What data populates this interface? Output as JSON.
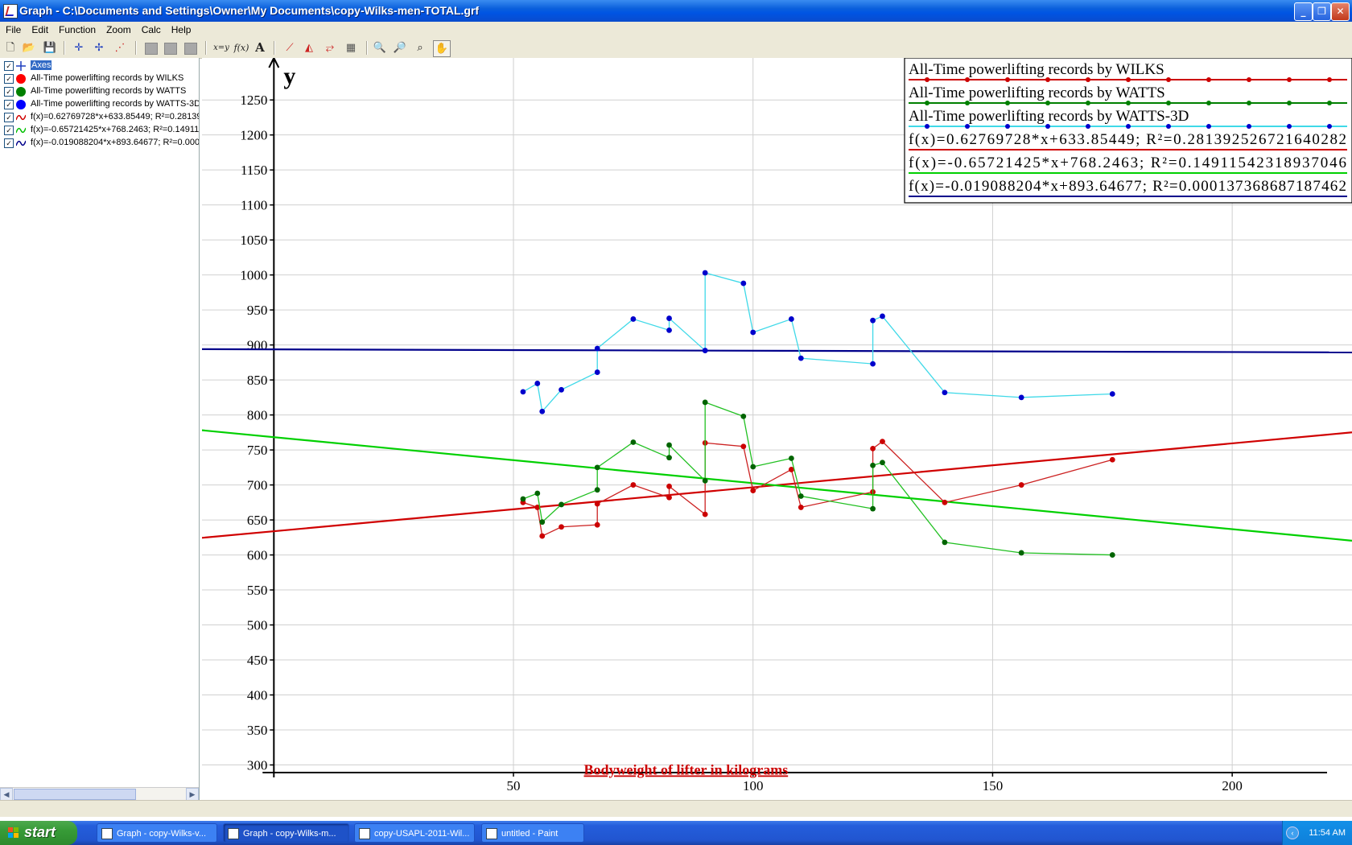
{
  "window": {
    "title": "Graph - C:\\Documents and Settings\\Owner\\My Documents\\copy-Wilks-men-TOTAL.grf"
  },
  "menu": [
    "File",
    "Edit",
    "Function",
    "Zoom",
    "Calc",
    "Help"
  ],
  "toolbar": {
    "xy_label": "x=y",
    "fx_label": "f(x)",
    "text_label": "A"
  },
  "panel": {
    "items": [
      {
        "label": "Axes",
        "checked": true,
        "icon": "axes-icon",
        "color": "#1f3fbf"
      },
      {
        "label": "All-Time powerlifting records by WILKS",
        "checked": true,
        "icon": "dot-icon",
        "color": "#ff0000"
      },
      {
        "label": "All-Time powerlifting records by WATTS",
        "checked": true,
        "icon": "dot-icon",
        "color": "#008000"
      },
      {
        "label": "All-Time powerlifting records by WATTS-3D",
        "checked": true,
        "icon": "dot-icon",
        "color": "#0000ff"
      },
      {
        "label": "f(x)=0.62769728*x+633.85449; R²=0.28139:",
        "checked": true,
        "icon": "curve-icon",
        "color": "#d00000"
      },
      {
        "label": "f(x)=-0.65721425*x+768.2463; R²=0.149115",
        "checked": true,
        "icon": "curve-icon",
        "color": "#00c000"
      },
      {
        "label": "f(x)=-0.019088204*x+893.64677; R²=0.0001",
        "checked": true,
        "icon": "curve-icon",
        "color": "#00008b"
      }
    ]
  },
  "chart_data": {
    "type": "scatter",
    "ylabel": "y",
    "annotation": "Bodyweight  of  lifter  in  kilograms",
    "x_ticks": [
      "50",
      "100",
      "150",
      "200"
    ],
    "y_ticks": [
      "300",
      "350",
      "400",
      "450",
      "500",
      "550",
      "600",
      "650",
      "700",
      "750",
      "800",
      "850",
      "900",
      "950",
      "1000",
      "1050",
      "1100",
      "1150",
      "1200",
      "1250"
    ],
    "xlim": [
      -15,
      225
    ],
    "ylim": [
      250,
      1310
    ],
    "legend_position": "top-right",
    "legend": [
      {
        "label": "All-Time powerlifting records by WILKS",
        "color": "#cc0000",
        "style": "dots"
      },
      {
        "label": "All-Time powerlifting records by WATTS",
        "color": "#008000",
        "style": "dots"
      },
      {
        "label": "All-Time powerlifting records by WATTS-3D",
        "color": "#0000cc",
        "line_color": "#3fd9e8",
        "style": "dots"
      },
      {
        "label": "f(x)=0.62769728*x+633.85449; R²=0.281392526721640282",
        "color": "#d00000",
        "style": "line"
      },
      {
        "label": "f(x)=-0.65721425*x+768.2463; R²=0.14911542318937046",
        "color": "#00d000",
        "style": "line"
      },
      {
        "label": "f(x)=-0.019088204*x+893.64677; R²=0.000137368687187462",
        "color": "#00008b",
        "style": "line"
      }
    ],
    "series": [
      {
        "name": "All-Time powerlifting records by WILKS",
        "point_color": "#cc0000",
        "line_color": "#cc2222",
        "points": [
          [
            52,
            675
          ],
          [
            55,
            668
          ],
          [
            56,
            627
          ],
          [
            60,
            640
          ],
          [
            67.5,
            643
          ],
          [
            67.5,
            673
          ],
          [
            75,
            700
          ],
          [
            82.5,
            682
          ],
          [
            82.5,
            698
          ],
          [
            90,
            658
          ],
          [
            90,
            760
          ],
          [
            98,
            755
          ],
          [
            100,
            692
          ],
          [
            108,
            722
          ],
          [
            110,
            668
          ],
          [
            125,
            690
          ],
          [
            125,
            752
          ],
          [
            127,
            762
          ],
          [
            140,
            675
          ],
          [
            156,
            700
          ],
          [
            175,
            736
          ]
        ]
      },
      {
        "name": "All-Time powerlifting records by WATTS",
        "point_color": "#006400",
        "line_color": "#22c022",
        "points": [
          [
            52,
            680
          ],
          [
            55,
            688
          ],
          [
            56,
            647
          ],
          [
            60,
            672
          ],
          [
            67.5,
            693
          ],
          [
            67.5,
            725
          ],
          [
            75,
            761
          ],
          [
            82.5,
            739
          ],
          [
            82.5,
            757
          ],
          [
            90,
            706
          ],
          [
            90,
            818
          ],
          [
            98,
            798
          ],
          [
            100,
            726
          ],
          [
            108,
            738
          ],
          [
            110,
            684
          ],
          [
            125,
            666
          ],
          [
            125,
            728
          ],
          [
            127,
            732
          ],
          [
            140,
            618
          ],
          [
            156,
            603
          ],
          [
            175,
            600
          ]
        ]
      },
      {
        "name": "All-Time powerlifting records by WATTS-3D",
        "point_color": "#0000cc",
        "line_color": "#3fd9e8",
        "points": [
          [
            52,
            833
          ],
          [
            55,
            845
          ],
          [
            56,
            805
          ],
          [
            60,
            836
          ],
          [
            67.5,
            861
          ],
          [
            67.5,
            895
          ],
          [
            75,
            937
          ],
          [
            82.5,
            921
          ],
          [
            82.5,
            938
          ],
          [
            90,
            892
          ],
          [
            90,
            1003
          ],
          [
            98,
            988
          ],
          [
            100,
            918
          ],
          [
            108,
            937
          ],
          [
            110,
            881
          ],
          [
            125,
            873
          ],
          [
            125,
            935
          ],
          [
            127,
            941
          ],
          [
            140,
            832
          ],
          [
            156,
            825
          ],
          [
            175,
            830
          ]
        ]
      }
    ],
    "regressions": [
      {
        "slope": 0.62769728,
        "intercept": 633.85449,
        "color": "#d00000"
      },
      {
        "slope": -0.65721425,
        "intercept": 768.2463,
        "color": "#00d000"
      },
      {
        "slope": -0.019088204,
        "intercept": 893.64677,
        "color": "#00008b"
      }
    ]
  },
  "taskbar": {
    "start_label": "start",
    "tasks": [
      {
        "label": "Graph - copy-Wilks-v...",
        "active": false
      },
      {
        "label": "Graph - copy-Wilks-m...",
        "active": true
      },
      {
        "label": "copy-USAPL-2011-Wil...",
        "active": false
      },
      {
        "label": "untitled - Paint",
        "active": false
      }
    ],
    "clock": "11:54 AM"
  }
}
